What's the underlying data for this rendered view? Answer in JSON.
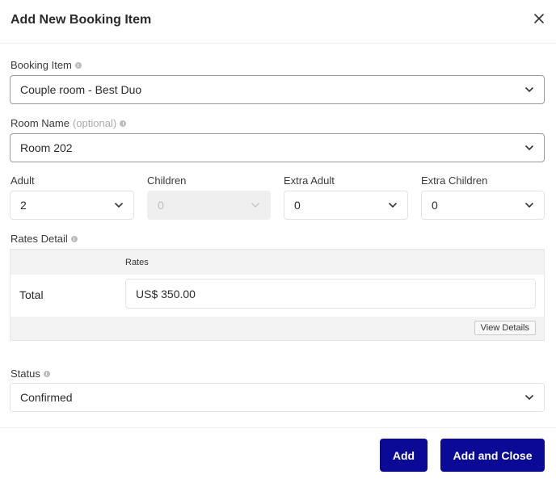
{
  "dialog": {
    "title": "Add New Booking Item",
    "close_icon": "close-icon"
  },
  "booking_item": {
    "label": "Booking Item",
    "info_icon": "info-icon",
    "value": "Couple room - Best Duo"
  },
  "room_name": {
    "label": "Room Name",
    "optional": "(optional)",
    "info_icon": "info-icon",
    "value": "Room 202"
  },
  "occupancy": {
    "adult": {
      "label": "Adult",
      "value": "2"
    },
    "children": {
      "label": "Children",
      "value": "0",
      "disabled": true
    },
    "extra_adult": {
      "label": "Extra Adult",
      "value": "0"
    },
    "extra_children": {
      "label": "Extra Children",
      "value": "0"
    }
  },
  "rates_detail": {
    "label": "Rates Detail",
    "info_icon": "info-icon",
    "column_header": "Rates",
    "row_label": "Total",
    "total_value": "US$ 350.00",
    "view_details_label": "View Details"
  },
  "status": {
    "label": "Status",
    "info_icon": "info-icon",
    "value": "Confirmed"
  },
  "footer": {
    "add_label": "Add",
    "add_close_label": "Add and Close",
    "button_color": "#0a0a96"
  }
}
